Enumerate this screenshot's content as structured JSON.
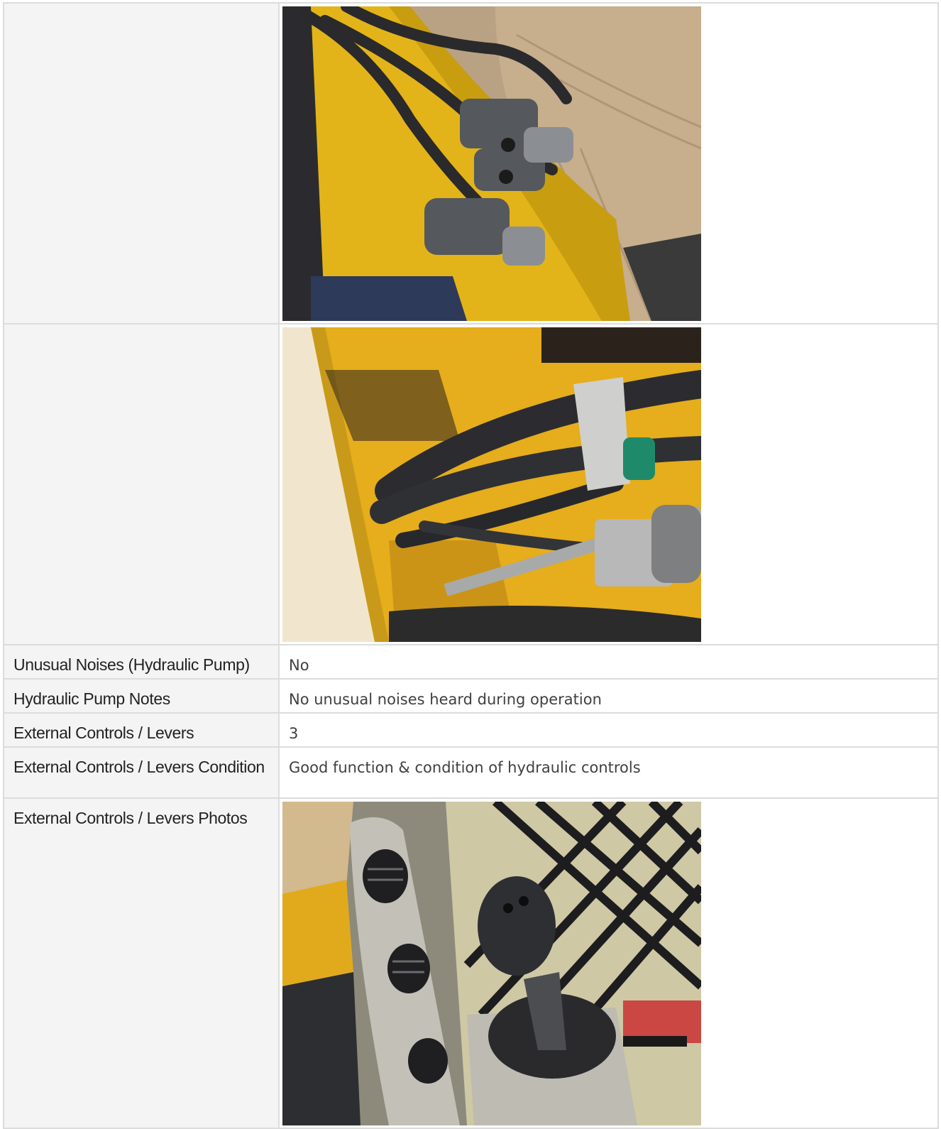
{
  "rows": [
    {
      "label": "",
      "photo": "hydraulic-couplers-photo"
    },
    {
      "label": "",
      "photo": "hydraulic-hoses-photo"
    },
    {
      "label": "Unusual Noises (Hydraulic Pump)",
      "value": "No"
    },
    {
      "label": "Hydraulic Pump Notes",
      "value": "No unusual noises heard during operation"
    },
    {
      "label": "External Controls / Levers",
      "value": "3"
    },
    {
      "label": "External Controls / Levers Condition",
      "value": "Good function & condition of hydraulic controls"
    },
    {
      "label": "External Controls / Levers Photos",
      "photo": "cab-joystick-photo"
    }
  ],
  "colors": {
    "label_bg": "#f4f4f4",
    "border": "#dcdcdc",
    "text": "#222222",
    "value_text": "#3f3f3f"
  }
}
